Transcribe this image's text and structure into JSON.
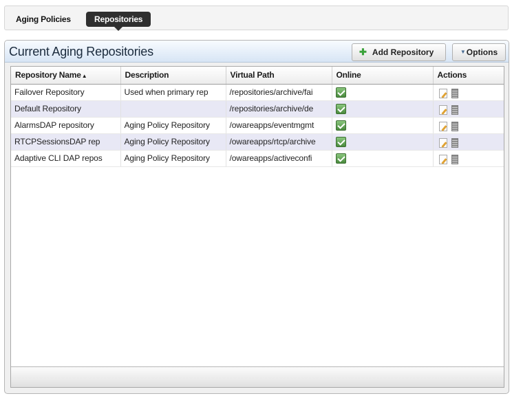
{
  "tabs": [
    {
      "label": "Aging Policies",
      "active": false
    },
    {
      "label": "Repositories",
      "active": true
    }
  ],
  "panel": {
    "title": "Current Aging Repositories",
    "add_button_label": "Add Repository",
    "options_button_label": "Options"
  },
  "table": {
    "columns": [
      {
        "label": "Repository Name",
        "sort": "asc"
      },
      {
        "label": "Description"
      },
      {
        "label": "Virtual Path"
      },
      {
        "label": "Online"
      },
      {
        "label": "Actions"
      }
    ],
    "rows": [
      {
        "name": "Failover Repository",
        "description": "Used when primary rep",
        "path": "/repositories/archive/fai",
        "online": true
      },
      {
        "name": "Default Repository",
        "description": "",
        "path": "/repositories/archive/de",
        "online": true
      },
      {
        "name": "AlarmsDAP repository",
        "description": "Aging Policy Repository",
        "path": "/owareapps/eventmgmt",
        "online": true
      },
      {
        "name": "RTCPSessionsDAP rep",
        "description": "Aging Policy Repository",
        "path": "/owareapps/rtcp/archive",
        "online": true
      },
      {
        "name": "Adaptive CLI DAP repos",
        "description": "Aging Policy Repository",
        "path": "/owareapps/activeconfi",
        "online": true
      }
    ]
  },
  "icons": {
    "add": "plus-icon",
    "options": "caret-down-icon",
    "sort": "sort-ascending-icon",
    "online": "checkbox-checked-icon",
    "edit": "edit-icon",
    "delete": "delete-icon"
  },
  "colors": {
    "active_tab": "#2f2f2f",
    "header_gradient_top": "#f8fbff",
    "header_gradient_bottom": "#d7e5f5",
    "alt_row": "#e8e8f5",
    "online_check": "#4a8a3d"
  }
}
